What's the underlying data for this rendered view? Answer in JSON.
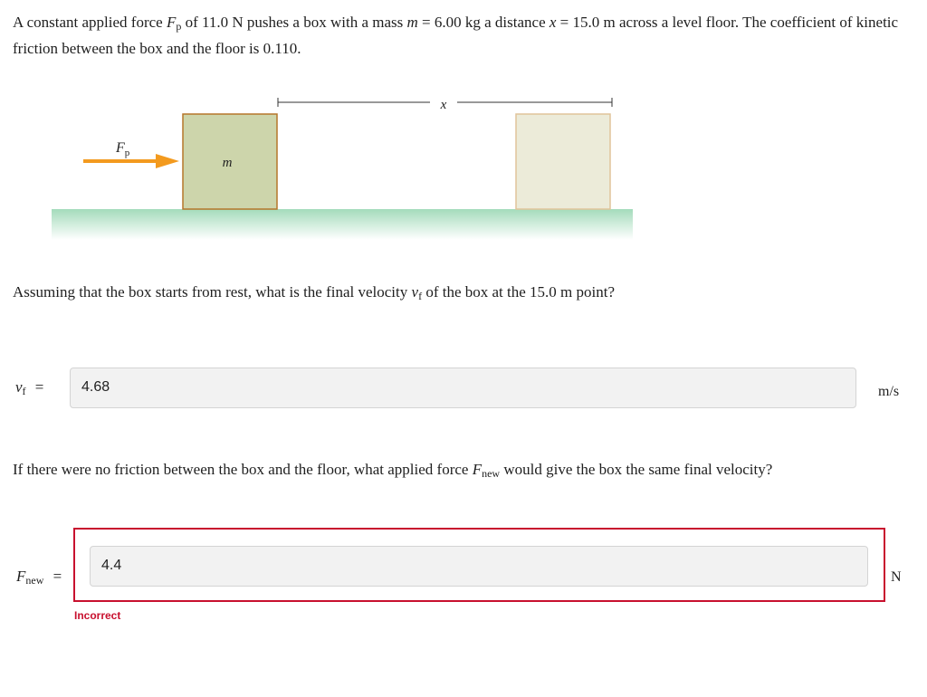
{
  "problem": {
    "part1": "A constant applied force ",
    "fp_symbol": "F",
    "fp_sub": "p",
    "part2": " of 11.0 N pushes a box with a mass ",
    "m_symbol": "m",
    "part3": " = 6.00 kg a distance ",
    "x_symbol": "x",
    "part4": " = 15.0 m across a level floor. The coefficient of kinetic friction between the box and the floor is 0.110."
  },
  "figure": {
    "force_label": "F",
    "force_sub": "p",
    "mass_label": "m",
    "distance_label": "x",
    "colors": {
      "arrow": "#f39a1e",
      "box1_fill": "#cdd5ab",
      "box1_border": "#b5762a",
      "box2_fill": "#ecebd9",
      "box2_border": "#e0c49a",
      "floor": "#a4dbbb"
    }
  },
  "question1": {
    "part1": "Assuming that the box starts from rest, what is the final velocity ",
    "v_symbol": "v",
    "v_sub": "f",
    "part2": " of the box at the 15.0 m point?",
    "answer_label": "v",
    "answer_label_sub": "f",
    "equals": "=",
    "answer_value": "4.68",
    "unit": "m/s"
  },
  "question2": {
    "part1": "If there were no friction between the box and the floor, what applied force ",
    "f_symbol": "F",
    "f_sub": "new",
    "part2": " would give the box the same final velocity?",
    "answer_label": "F",
    "answer_label_sub": "new",
    "equals": "=",
    "answer_value": "4.4",
    "unit": "N",
    "status": "Incorrect"
  }
}
